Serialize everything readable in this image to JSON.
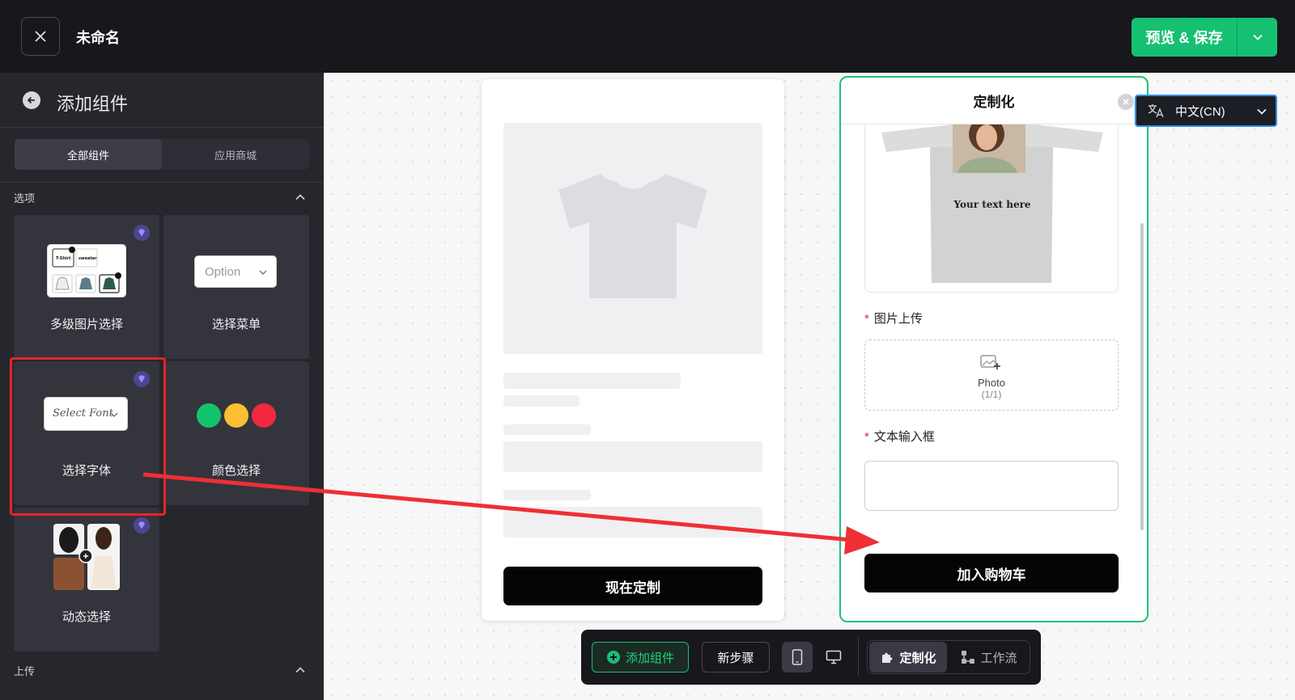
{
  "header": {
    "title": "未命名",
    "save_label": "预览 & 保存"
  },
  "sidebar": {
    "title": "添加组件",
    "tabs": [
      {
        "label": "全部组件",
        "active": true
      },
      {
        "label": "应用商城",
        "active": false
      }
    ],
    "sections": [
      {
        "label": "选项",
        "items": [
          {
            "label": "多级图片选择",
            "premium": true,
            "thumb_texts": [
              "T-Shirt",
              "sweater"
            ]
          },
          {
            "label": "选择菜单",
            "premium": false,
            "preview_text": "Option"
          },
          {
            "label": "选择字体",
            "premium": true,
            "preview_text": "Select Font",
            "highlighted": true
          },
          {
            "label": "颜色选择",
            "premium": false,
            "swatches": [
              "#13c46d",
              "#fbbf33",
              "#f0293e"
            ]
          },
          {
            "label": "动态选择",
            "premium": true
          }
        ]
      },
      {
        "label": "上传"
      }
    ]
  },
  "preview": {
    "button_label": "现在定制"
  },
  "custom_panel": {
    "title": "定制化",
    "shirt_text": "Your text here",
    "upload": {
      "label": "图片上传",
      "text": "Photo",
      "count": "(1/1)"
    },
    "text_field": {
      "label": "文本输入框"
    },
    "button_label": "加入购物车"
  },
  "language": {
    "label": "中文(CN)"
  },
  "toolbar": {
    "add_label": "添加组件",
    "step_label": "新步骤",
    "custom_label": "定制化",
    "workflow_label": "工作流"
  },
  "colors": {
    "accent": "#16c07a",
    "highlight": "#e3262a",
    "dark": "#17171c"
  }
}
